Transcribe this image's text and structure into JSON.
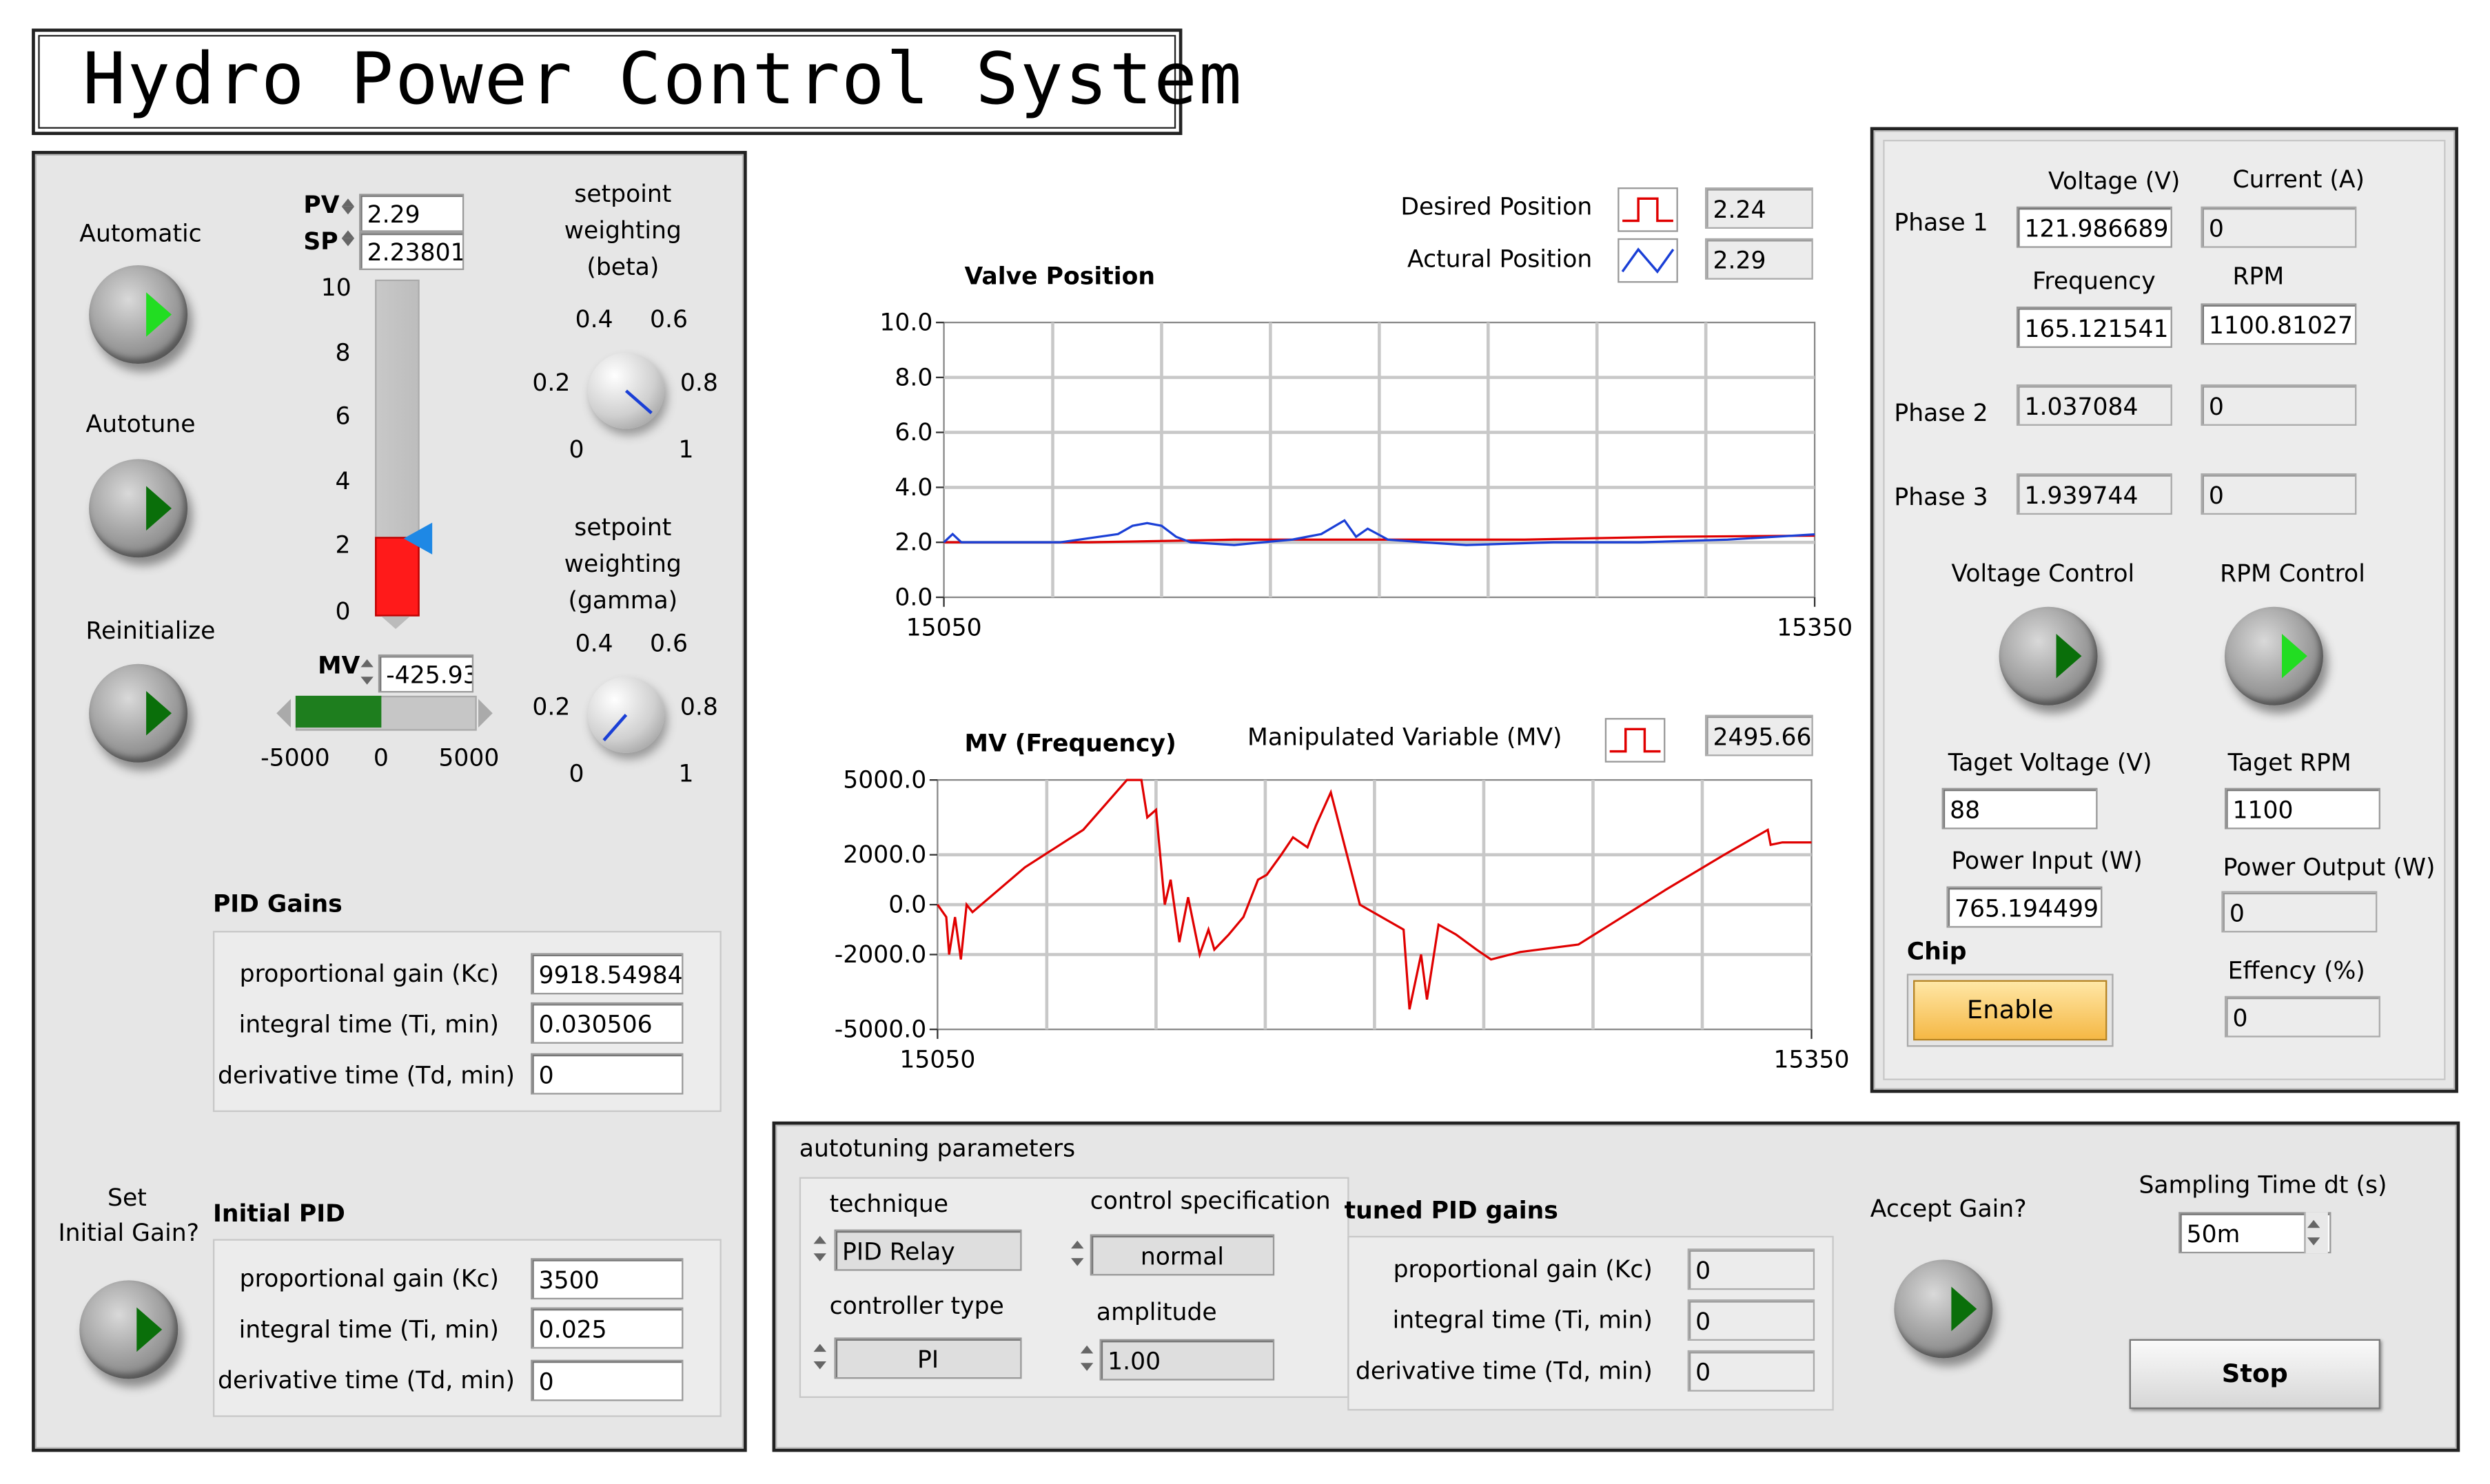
{
  "title": "Hydro Power Control System",
  "left": {
    "automatic_label": "Automatic",
    "autotune_label": "Autotune",
    "reinitialize_label": "Reinitialize",
    "set_initial_gain_label_1": "Set",
    "set_initial_gain_label_2": "Initial Gain?",
    "pv_label": "PV",
    "sp_label": "SP",
    "pv_value": "2.29",
    "sp_value": "2.23801",
    "pv_fraction": 0.229,
    "sp_fraction": 0.2238,
    "slider_ticks": [
      "10",
      "8",
      "6",
      "4",
      "2",
      "0"
    ],
    "mv_label": "MV",
    "mv_value": "-425.93",
    "mv_ticks": [
      "-5000",
      "0",
      "5000"
    ],
    "beta_label_1": "setpoint",
    "beta_label_2": "weighting",
    "beta_label_3": "(beta)",
    "gamma_label_1": "setpoint",
    "gamma_label_2": "weighting",
    "gamma_label_3": "(gamma)",
    "knob_ticks": {
      "t0": "0",
      "t02": "0.2",
      "t04": "0.4",
      "t06": "0.6",
      "t08": "0.8",
      "t1": "1"
    },
    "pid_gains": {
      "title": "PID Gains",
      "kc_label": "proportional gain (Kc)",
      "ti_label": "integral time (Ti, min)",
      "td_label": "derivative time (Td, min)",
      "kc": "9918.54984",
      "ti": "0.030506",
      "td": "0"
    },
    "initial_pid": {
      "title": "Initial PID",
      "kc_label": "proportional gain (Kc)",
      "ti_label": "integral time (Ti, min)",
      "td_label": "derivative time (Td, min)",
      "kc": "3500",
      "ti": "0.025",
      "td": "0"
    }
  },
  "center": {
    "legend_desired": "Desired Position",
    "legend_actual": "Actural Position",
    "desired_value": "2.24",
    "actual_value": "2.29",
    "mv_legend": "Manipulated Variable (MV)",
    "mv_value": "2495.66",
    "autotune": {
      "title": "autotuning parameters",
      "technique_label": "technique",
      "technique_value": "PID Relay",
      "control_spec_label": "control specification",
      "control_spec_value": "normal",
      "controller_type_label": "controller type",
      "controller_type_value": "PI",
      "amplitude_label": "amplitude",
      "amplitude_value": "1.00",
      "tuned_title": "tuned PID gains",
      "kc_label": "proportional gain (Kc)",
      "ti_label": "integral time (Ti, min)",
      "td_label": "derivative time (Td, min)",
      "kc": "0",
      "ti": "0",
      "td": "0",
      "accept_label": "Accept Gain?",
      "sampling_label": "Sampling Time dt (s)",
      "sampling_value": "50m",
      "stop_label": "Stop"
    }
  },
  "right": {
    "voltage_header": "Voltage (V)",
    "current_header": "Current (A)",
    "frequency_header": "Frequency",
    "rpm_header": "RPM",
    "phase1_label": "Phase 1",
    "phase2_label": "Phase 2",
    "phase3_label": "Phase 3",
    "p1_voltage": "121.986689",
    "p1_current": "0",
    "p1_frequency": "165.121541",
    "p1_rpm": "1100.81027",
    "p2_voltage": "1.037084",
    "p2_current": "0",
    "p3_voltage": "1.939744",
    "p3_current": "0",
    "voltage_control_label": "Voltage Control",
    "rpm_control_label": "RPM Control",
    "target_voltage_label": "Taget Voltage (V)",
    "target_voltage": "88",
    "target_rpm_label": "Taget RPM",
    "target_rpm": "1100",
    "power_input_label": "Power Input (W)",
    "power_input": "765.194499",
    "power_output_label": "Power Output (W)",
    "power_output": "0",
    "chip_label": "Chip",
    "enable_label": "Enable",
    "efficiency_label": "Effency (%)",
    "efficiency": "0"
  },
  "colors": {
    "desired_series": "#e00000",
    "actual_series": "#1a3fd6",
    "mv_series": "#e00000",
    "mv_bar": "#1e7e1e",
    "pv_fill": "#ff1a1a",
    "sp_marker": "#1e88e5",
    "led_on": "#22dd22",
    "led_off": "#0a6f0a",
    "enable_button": "#f5b845"
  },
  "chart_data": [
    {
      "type": "line",
      "title": "Valve Position",
      "xlim": [
        15050,
        15350
      ],
      "ylim": [
        0,
        10
      ],
      "x_ticks": [
        "15050",
        "15350"
      ],
      "y_ticks": [
        "10.0",
        "8.0",
        "6.0",
        "4.0",
        "2.0",
        "0.0"
      ],
      "grid": true,
      "series": [
        {
          "name": "Desired Position",
          "x": [
            15050,
            15100,
            15150,
            15200,
            15250,
            15300,
            15350
          ],
          "values": [
            2.0,
            2.0,
            2.1,
            2.1,
            2.1,
            2.2,
            2.24
          ]
        },
        {
          "name": "Actural Position",
          "x": [
            15050,
            15053,
            15056,
            15070,
            15090,
            15110,
            15115,
            15120,
            15125,
            15130,
            15135,
            15150,
            15160,
            15170,
            15180,
            15188,
            15192,
            15196,
            15203,
            15215,
            15230,
            15260,
            15290,
            15320,
            15350
          ],
          "values": [
            2.0,
            2.3,
            2.0,
            2.0,
            2.0,
            2.3,
            2.6,
            2.7,
            2.6,
            2.2,
            2.0,
            1.9,
            2.0,
            2.1,
            2.3,
            2.8,
            2.2,
            2.5,
            2.1,
            2.0,
            1.9,
            2.0,
            2.0,
            2.1,
            2.29
          ]
        }
      ]
    },
    {
      "type": "line",
      "title": "MV (Frequency)",
      "xlim": [
        15050,
        15350
      ],
      "ylim": [
        -5000,
        5000
      ],
      "x_ticks": [
        "15050",
        "15350"
      ],
      "y_ticks": [
        "5000.0",
        "2000.0",
        "0.0",
        "-2000.0",
        "-5000.0"
      ],
      "grid": true,
      "series": [
        {
          "name": "Manipulated Variable (MV)",
          "x": [
            15050,
            15053,
            15054,
            15056,
            15058,
            15060,
            15062,
            15080,
            15100,
            15115,
            15120,
            15122,
            15125,
            15128,
            15130,
            15133,
            15136,
            15140,
            15143,
            15145,
            15150,
            15155,
            15160,
            15163,
            15168,
            15172,
            15177,
            15180,
            15185,
            15195,
            15210,
            15212,
            15216,
            15218,
            15222,
            15228,
            15235,
            15240,
            15250,
            15270,
            15300,
            15320,
            15335,
            15336,
            15340,
            15350
          ],
          "values": [
            0.0,
            -500,
            -2000,
            -500,
            -2200,
            0.0,
            -300,
            1500,
            3000,
            5000,
            5000,
            3500,
            3800,
            0.0,
            1000,
            -1500,
            300,
            -2000,
            -1000,
            -1800,
            -1200,
            -500,
            1000,
            1200,
            2000,
            2700,
            2300,
            3200,
            4500,
            0.0,
            -1000,
            -4200,
            -2000,
            -3800,
            -800,
            -1200,
            -1800,
            -2200,
            -1900,
            -1600,
            600,
            2000,
            3000,
            2400,
            2500,
            2496
          ]
        }
      ]
    }
  ]
}
